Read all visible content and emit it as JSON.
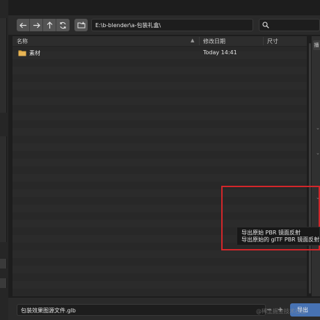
{
  "toolbar": {
    "path": "E:\\b-blender\\a-包装礼盒\\",
    "search_icon": "magnifier-icon",
    "nav_icons": [
      "arrow-left-icon",
      "arrow-right-icon",
      "arrow-up-icon",
      "refresh-icon"
    ],
    "new_folder_icon": "folder-plus-icon"
  },
  "columns": {
    "name": "名称",
    "modified": "修改日期",
    "size": "尺寸"
  },
  "files": [
    {
      "name": "素材",
      "modified": "Today 14:41",
      "icon": "folder-icon"
    }
  ],
  "right_panel": {
    "tab_label": "播"
  },
  "tooltip": {
    "line1": "导出原始 PBR 镜面反射",
    "line2": "导出原始的 glTF PBR 镜面反射,"
  },
  "bottom": {
    "filename": "包装效果图源文件.glb",
    "minus": "−",
    "plus": "+",
    "export_label": "导出"
  },
  "watermark": "@稀土掘金技术社区",
  "colors": {
    "accent": "#4772b3",
    "highlight_border": "#d4262a",
    "folder": "#d9a441"
  }
}
